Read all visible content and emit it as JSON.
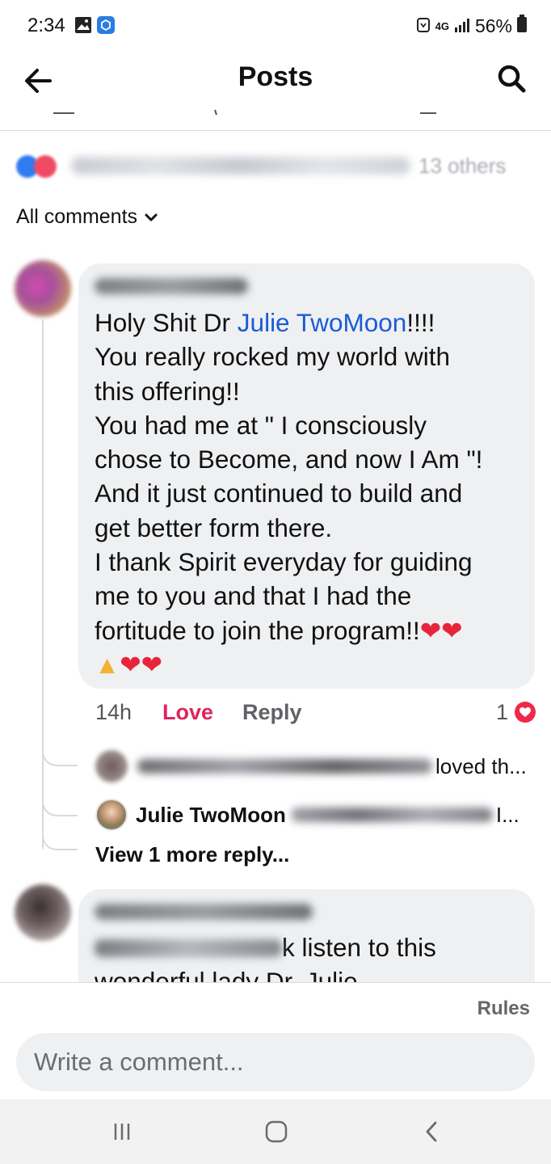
{
  "status_bar": {
    "time": "2:34",
    "network": "4G",
    "battery": "56%"
  },
  "header": {
    "title": "Posts"
  },
  "reactions": {
    "others": "13 others"
  },
  "filter": {
    "label": "All comments"
  },
  "comment1": {
    "lines": [
      [
        "Holy Shit Dr ",
        "Julie TwoMoon",
        "!!!!"
      ],
      "You really rocked my world with",
      "this offering!!",
      "You had me at \" I consciously",
      "chose to Become, and now I Am \"!",
      "And it just continued to build and",
      "get better form there.",
      "I thank Spirit everyday for guiding",
      "me to you and that I had the",
      "fortitude to join the program!!"
    ],
    "time": "14h",
    "love_label": "Love",
    "reply_label": "Reply",
    "reaction_count": "1"
  },
  "replies": [
    {
      "text": "loved th..."
    },
    {
      "author": "Julie TwoMoon",
      "text": "I..."
    }
  ],
  "view_more": "View 1 more reply...",
  "comment2": {
    "line1": "k listen to this",
    "line2": "wonderful lady Dr. Julie"
  },
  "footer": {
    "rules": "Rules",
    "placeholder": "Write a comment..."
  },
  "colors": {
    "mention": "#1a5bd6",
    "love": "#e0245e",
    "bubble": "#eff0f2"
  }
}
